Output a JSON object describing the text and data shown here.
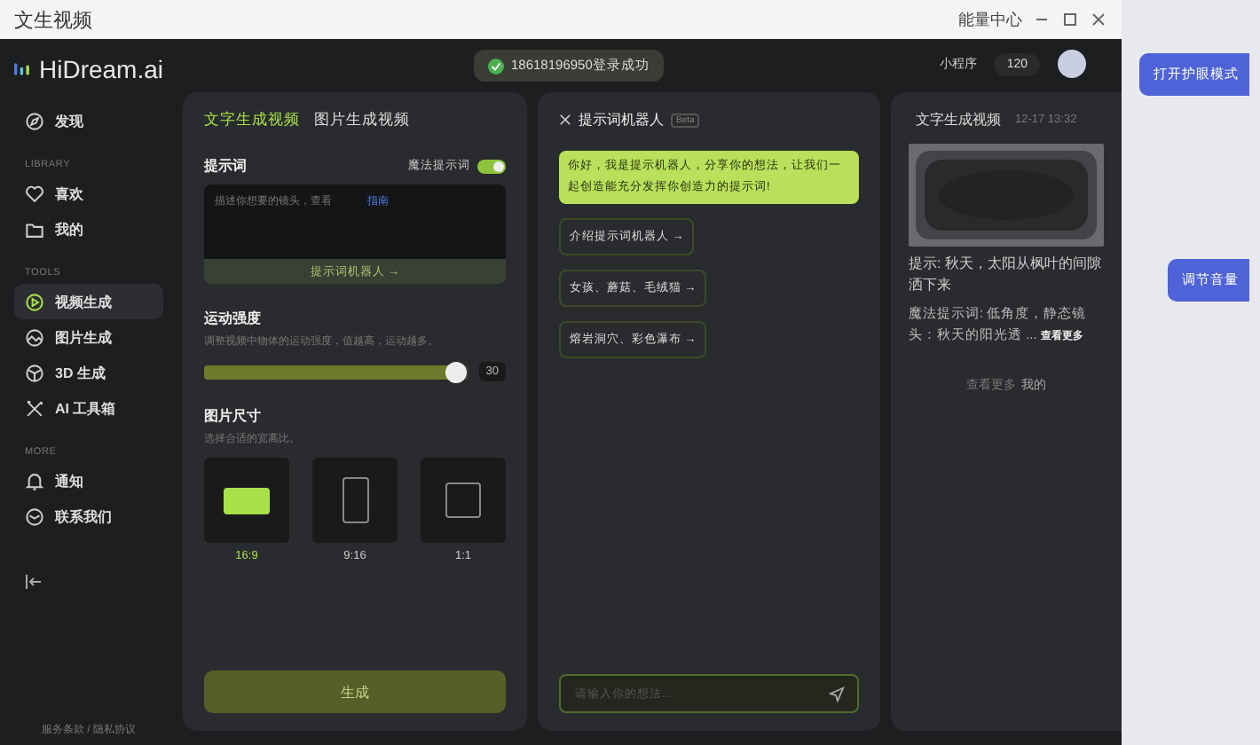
{
  "window": {
    "title": "文生视频",
    "energy_center": "能量中心"
  },
  "header": {
    "brand": "HiDream.ai",
    "toast": "18618196950登录成功",
    "mini_program": "小程序",
    "credits": "120"
  },
  "sidebar": {
    "sections": [
      {
        "items": [
          {
            "label": "发现",
            "selected": false
          }
        ]
      },
      {
        "heading": "LIBRARY",
        "items": [
          {
            "label": "喜欢",
            "selected": false
          },
          {
            "label": "我的",
            "selected": false
          }
        ]
      },
      {
        "heading": "TOOLS",
        "items": [
          {
            "label": "视频生成",
            "selected": true
          },
          {
            "label": "图片生成",
            "selected": false
          },
          {
            "label": "3D 生成",
            "selected": false
          },
          {
            "label": "AI 工具箱",
            "selected": false
          }
        ]
      },
      {
        "heading": "MORE",
        "items": [
          {
            "label": "通知",
            "selected": false
          },
          {
            "label": "联系我们",
            "selected": false
          }
        ]
      }
    ],
    "footer": "服务条款 / 隐私协议"
  },
  "generator": {
    "tabs": [
      {
        "label": "文字生成视频",
        "selected": true
      },
      {
        "label": "图片生成视频",
        "selected": false
      }
    ],
    "prompt_label": "提示词",
    "magic_toggle": {
      "label": "魔法提示词",
      "on": true
    },
    "prompt_field": {
      "placeholder": "描述你想要的镜头，查看",
      "link": "指南"
    },
    "robot_button": "提示词机器人 →",
    "motion": {
      "title": "运动强度",
      "description": "调整视频中物体的运动强度，值越高，运动越多。",
      "level": 0.96,
      "value": "30"
    },
    "size": {
      "title": "图片尺寸",
      "description": "选择合适的宽高比。",
      "options": [
        {
          "label": "16:9",
          "selected": true
        },
        {
          "label": "9:16",
          "selected": false
        },
        {
          "label": "1:1",
          "selected": false
        }
      ]
    },
    "generate_button": "生成"
  },
  "robot": {
    "title": "提示词机器人",
    "badge": "Beta",
    "greeting": "你好，我是提示机器人，分享你的想法，让我们一起创造能充分发挥你创造力的提示词!",
    "suggestions": [
      "介绍提示词机器人 →",
      "女孩、蘑菇、毛绒猫 →",
      "熔岩洞穴、彩色瀑布 →"
    ],
    "input": {
      "placeholder": "请输入你的想法..."
    }
  },
  "history": {
    "title": "文字生成视频",
    "time": "12-17 13:32",
    "prompt": "提示: 秋天，太阳从枫叶的间隙洒下来",
    "magic": "魔法提示词: 低角度，静态镜头：秋天的阳光透 ...",
    "more": "查看更多",
    "footer": "查看更多",
    "footer_link": "我的"
  },
  "side_window": {
    "buttons": [
      "打开护眼模式",
      "调节音量"
    ]
  }
}
